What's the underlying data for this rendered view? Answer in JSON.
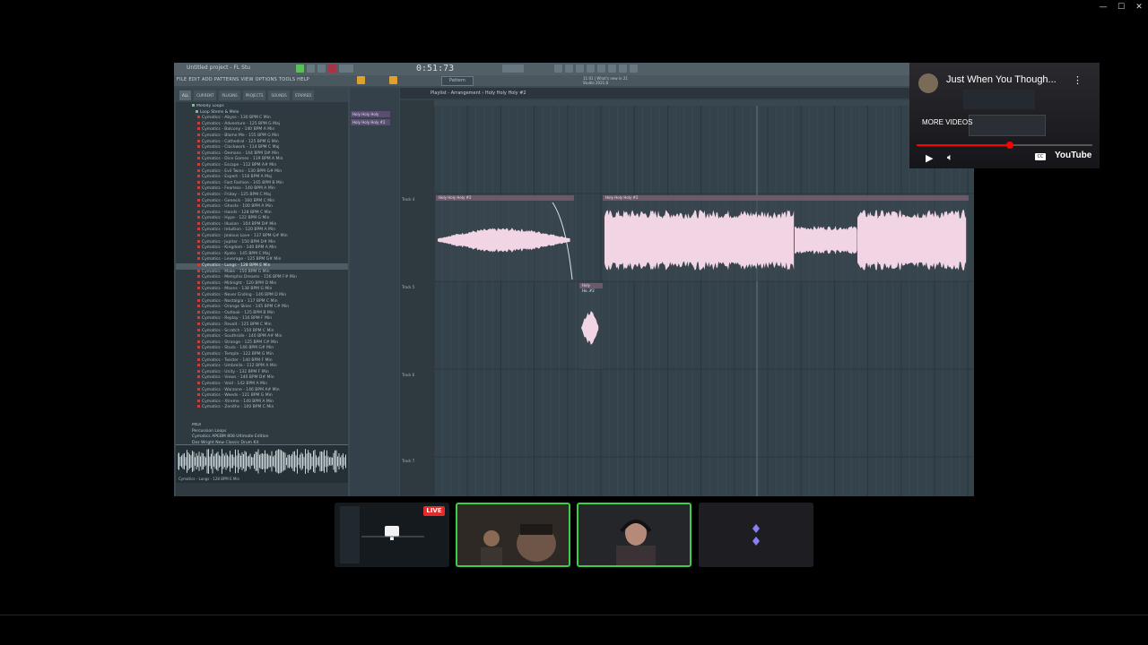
{
  "window_controls": {
    "minimize": "—",
    "maximize": "☐",
    "close": "✕"
  },
  "fl": {
    "project_title": "Untitled project - FL Stu",
    "time_display": "0:51:73",
    "menu": "FILE  EDIT  ADD  PATTERNS  VIEW  OPTIONS  TOOLS  HELP",
    "pattern_label": "Pattern",
    "hint_line1": "11:01 | What's new in 21",
    "hint_line2": "Studio 2021.8",
    "browser_tabs": [
      "ALL",
      "CURRENT",
      "PLUGINS",
      "PROJECTS",
      "SOUNDS",
      "STARRED"
    ],
    "browser_title": "Browser",
    "tree_folders": [
      "Melody Loops",
      "Loop Stems & Melo"
    ],
    "tree_items": [
      "Cymatics - Abyss - 130 BPM C Min",
      "Cymatics - Adventure - 125 BPM G Maj",
      "Cymatics - Balcony - 140 BPM A Min",
      "Cymatics - Blame Me - 155 BPM G Min",
      "Cymatics - Cathedral - 125 BPM G Min",
      "Cymatics - Clockwork - 114 BPM C Maj",
      "Cymatics - Demons - 144 BPM D# Min",
      "Cymatics - Dice Games - 119 BPM A Min",
      "Cymatics - Escape - 112 BPM A# Min",
      "Cymatics - Evil Twins - 130 BPM G# Min",
      "Cymatics - Expert - 118 BPM A Maj",
      "Cymatics - Fast Fashion - 165 BPM B Min",
      "Cymatics - Fearless - 140 BPM A Min",
      "Cymatics - Friday - 125 BPM C Maj",
      "Cymatics - Genesis - 160 BPM C Min",
      "Cymatics - Ghosts - 100 BPM A Min",
      "Cymatics - Hands - 128 BPM C Min",
      "Cymatics - Hype - 122 BPM G Min",
      "Cymatics - Illusion - 104 BPM D# Min",
      "Cymatics - Intuition - 120 BPM A Min",
      "Cymatics - Jealous Love - 137 BPM G# Min",
      "Cymatics - Jupiter - 150 BPM D# Min",
      "Cymatics - Kingdom - 140 BPM A Min",
      "Cymatics - Kyoto - 145 BPM C Maj",
      "Cymatics - Leverage - 125 BPM G# Min",
      "Cymatics - Lungs - 128 BPM E Min",
      "Cymatics - Make - 150 BPM G Min",
      "Cymatics - Memphis Dreams - 156 BPM F# Min",
      "Cymatics - Midnight - 120 BPM D Min",
      "Cymatics - Moons - 138 BPM G Min",
      "Cymatics - Never Ending - 146 BPM D Min",
      "Cymatics - Nostalgia - 117 BPM C Min",
      "Cymatics - Orange Skies - 145 BPM C# Min",
      "Cymatics - Outlook - 125 BPM B Min",
      "Cymatics - Replay - 116 BPM F Min",
      "Cymatics - Revolt - 125 BPM C Min",
      "Cymatics - Scratch - 150 BPM C Min",
      "Cymatics - Southside - 140 BPM A# Min",
      "Cymatics - Strange - 125 BPM C# Min",
      "Cymatics - Stuck - 146 BPM G# Min",
      "Cymatics - Temple - 122 BPM G Min",
      "Cymatics - Twister - 140 BPM F Min",
      "Cymatics - Umbrella - 112 BPM A Min",
      "Cymatics - Unity - 132 BPM F Min",
      "Cymatics - Views - 140 BPM D# Min",
      "Cymatics - Void - 142 BPM A Min",
      "Cymatics - Warzone - 146 BPM A# Min",
      "Cymatics - Weeds - 121 BPM G Min",
      "Cymatics - Xtreme - 140 BPM A Min",
      "Cymatics - Zeniths - 100 BPM C Min"
    ],
    "selected_item_index": 25,
    "tree_lower": [
      "MIDI",
      "Percussion Loops",
      "Cymatics APEBM 808 Ultimate Edition",
      "Dez Wright New Classic Drum Kit",
      "DK"
    ],
    "sample_label": "Cymatics - Lungs - 128 BPM E Min",
    "patterns": [
      "Holy Holy Holy",
      "Holy Holy Holy #2"
    ],
    "playlist_title": "Playlist - Arrangement › Holy Holy Holy #2",
    "tracks": [
      "Track 4",
      "Track 5",
      "Track 6",
      "Track 7"
    ],
    "clips": [
      "Holy Holy Holy #2",
      "Holy Holy Holy #2",
      "Holy Ho..#2"
    ]
  },
  "youtube": {
    "title": "Just When You Though...",
    "more_videos": "MORE VIDEOS",
    "logo": "YouTube",
    "progress": 0.53,
    "accent": "#ff0000"
  },
  "cams": {
    "live_badge": "LIVE",
    "active_border": "#3ecf4a"
  },
  "colors": {
    "waveform": "#f1d5e4",
    "fl_bg": "#3c4a52"
  }
}
